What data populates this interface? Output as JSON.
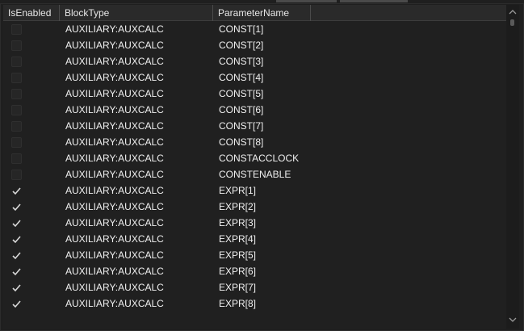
{
  "columns": {
    "is_enabled": "IsEnabled",
    "block_type": "BlockType",
    "parameter_name": "ParameterName"
  },
  "rows": [
    {
      "enabled": false,
      "block": "AUXILIARY:AUXCALC",
      "param": "CONST[1]"
    },
    {
      "enabled": false,
      "block": "AUXILIARY:AUXCALC",
      "param": "CONST[2]"
    },
    {
      "enabled": false,
      "block": "AUXILIARY:AUXCALC",
      "param": "CONST[3]"
    },
    {
      "enabled": false,
      "block": "AUXILIARY:AUXCALC",
      "param": "CONST[4]"
    },
    {
      "enabled": false,
      "block": "AUXILIARY:AUXCALC",
      "param": "CONST[5]"
    },
    {
      "enabled": false,
      "block": "AUXILIARY:AUXCALC",
      "param": "CONST[6]"
    },
    {
      "enabled": false,
      "block": "AUXILIARY:AUXCALC",
      "param": "CONST[7]"
    },
    {
      "enabled": false,
      "block": "AUXILIARY:AUXCALC",
      "param": "CONST[8]"
    },
    {
      "enabled": false,
      "block": "AUXILIARY:AUXCALC",
      "param": "CONSTACCLOCK"
    },
    {
      "enabled": false,
      "block": "AUXILIARY:AUXCALC",
      "param": "CONSTENABLE"
    },
    {
      "enabled": true,
      "block": "AUXILIARY:AUXCALC",
      "param": "EXPR[1]"
    },
    {
      "enabled": true,
      "block": "AUXILIARY:AUXCALC",
      "param": "EXPR[2]"
    },
    {
      "enabled": true,
      "block": "AUXILIARY:AUXCALC",
      "param": "EXPR[3]"
    },
    {
      "enabled": true,
      "block": "AUXILIARY:AUXCALC",
      "param": "EXPR[4]"
    },
    {
      "enabled": true,
      "block": "AUXILIARY:AUXCALC",
      "param": "EXPR[5]"
    },
    {
      "enabled": true,
      "block": "AUXILIARY:AUXCALC",
      "param": "EXPR[6]"
    },
    {
      "enabled": true,
      "block": "AUXILIARY:AUXCALC",
      "param": "EXPR[7]"
    },
    {
      "enabled": true,
      "block": "AUXILIARY:AUXCALC",
      "param": "EXPR[8]"
    }
  ],
  "icons": {
    "check": "checkmark-icon",
    "scroll_up": "chevron-up-icon",
    "scroll_down": "chevron-down-icon"
  },
  "colors": {
    "background": "#202020",
    "header": "#2a2a2a",
    "text": "#f0f0f0",
    "check": "#d8d8d8"
  }
}
